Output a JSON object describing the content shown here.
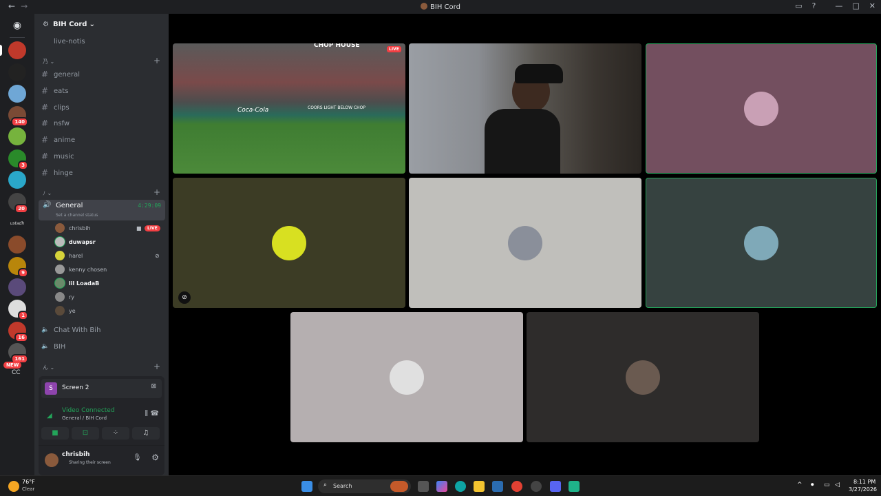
{
  "window": {
    "title": "BIH Cord"
  },
  "server": {
    "name": "BIH Cord"
  },
  "channels": {
    "top": "live-notis",
    "category1": "乃",
    "list": [
      "general",
      "eats",
      "clips",
      "nsfw",
      "anime",
      "music",
      "hinge"
    ],
    "category2": "ﾉ",
    "category3": "ん"
  },
  "voice": {
    "name": "General",
    "timer": "4:29:09",
    "status": "Set a channel status",
    "other1": "Chat With Bih",
    "other2": "BIH"
  },
  "voice_users": [
    {
      "name": "chrisbih",
      "live": "LIVE"
    },
    {
      "name": "duwapsr"
    },
    {
      "name": "harel"
    },
    {
      "name": "kenny chosen"
    },
    {
      "name": "lil LoadaB"
    },
    {
      "name": "ry"
    },
    {
      "name": "ye"
    }
  ],
  "guild_badges": [
    "140",
    "3",
    "20",
    "9",
    "1",
    "16",
    "161"
  ],
  "guild_new": "NEW",
  "guild_text": "ustadh",
  "guild_cc": "CC",
  "panel": {
    "screen": "Screen 2",
    "screen_letter": "S",
    "connected": "Video Connected",
    "location": "General / BIH Cord"
  },
  "account": {
    "name": "chrisbih",
    "status": "Sharing their screen"
  },
  "video": {
    "banner": "CHOP HOUSE",
    "live": "LIVE",
    "ad1": "Coca-Cola",
    "ad2": "COORS LIGHT BELOW CHOP"
  },
  "taskbar": {
    "temp": "76°F",
    "weather": "Clear",
    "search": "Search",
    "time": "8:11 PM",
    "date": "3/27/2026"
  }
}
